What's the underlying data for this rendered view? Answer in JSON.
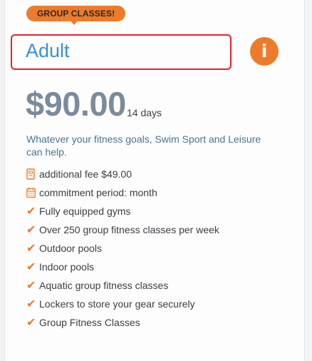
{
  "badge": {
    "label": "GROUP CLASSES!"
  },
  "plan": {
    "title": "Adult",
    "info_icon_glyph": "i",
    "price": "$90.00",
    "price_separator": "/",
    "period": "14 days",
    "description": "Whatever your fitness goals, Swim Sport and Leisure can help."
  },
  "details": [
    {
      "icon": "fee-icon",
      "text": "additional fee $49.00"
    },
    {
      "icon": "calendar-icon",
      "text": "commitment period: month"
    }
  ],
  "features": [
    "Fully equipped gyms",
    "Over 250 group fitness classes per week",
    "Outdoor pools",
    "Indoor pools",
    "Aquatic group fitness classes",
    "Lockers to store your gear securely",
    "Group Fitness Classes"
  ],
  "colors": {
    "accent_orange": "#ee7b2b",
    "title_blue": "#3d8fcf",
    "price_gray": "#7a8b9c",
    "highlight_red": "#e3242b"
  }
}
